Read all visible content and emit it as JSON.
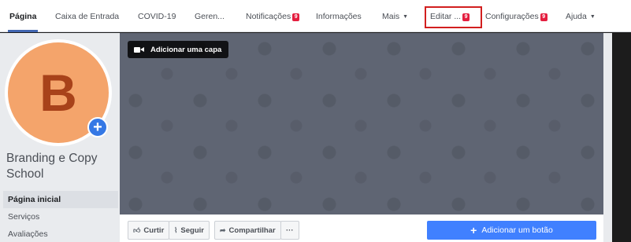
{
  "nav": {
    "items": [
      {
        "label": "Página"
      },
      {
        "label": "Caixa de Entrada"
      },
      {
        "label": "COVID-19"
      },
      {
        "label": "Geren..."
      },
      {
        "label": "Notificações",
        "badge": "9"
      },
      {
        "label": "Informações"
      },
      {
        "label": "Mais"
      },
      {
        "label": "Editar ...",
        "badge": "9"
      },
      {
        "label": "Configurações",
        "badge": "9"
      },
      {
        "label": "Ajuda"
      }
    ]
  },
  "profile": {
    "avatar_letter": "B",
    "name": "Branding e Copy School",
    "avatar_color": "#f4a46b",
    "avatar_letter_color": "#a8421a"
  },
  "side_nav": [
    {
      "label": "Página inicial"
    },
    {
      "label": "Serviços"
    },
    {
      "label": "Avaliações"
    }
  ],
  "cover": {
    "add_cover_label": "Adicionar uma capa",
    "color": "#5f6573"
  },
  "actions": {
    "like": "Curtir",
    "follow": "Seguir",
    "share": "Compartilhar",
    "more": "···",
    "add_button": "Adicionar um botão"
  },
  "colors": {
    "accent": "#4267b2",
    "primary_button": "#4080ff",
    "badge": "#e41e3f",
    "highlight_box": "#d21f1f"
  }
}
